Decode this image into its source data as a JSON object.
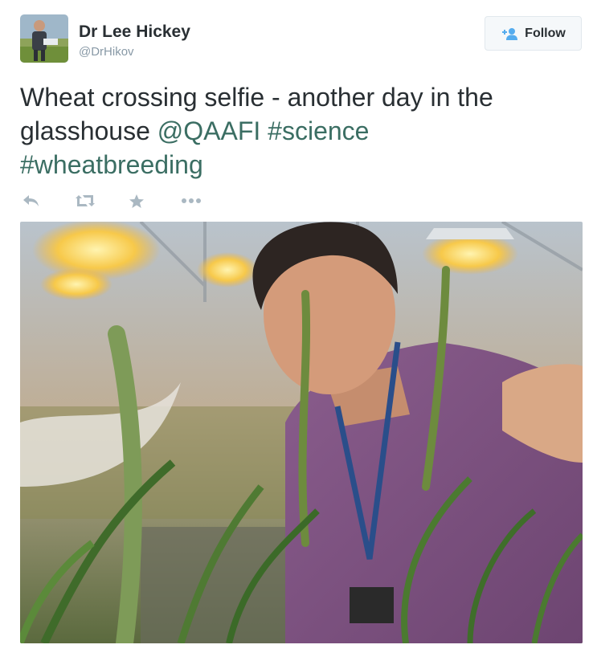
{
  "author": {
    "name": "Dr Lee Hickey",
    "handle": "@DrHikov"
  },
  "follow_button": {
    "label": "Follow"
  },
  "tweet": {
    "text_lead": "Wheat crossing selfie - another day in the glasshouse ",
    "mention": "@QAAFI",
    "hashtag1": "#science",
    "hashtag2": "#wheatbreeding"
  },
  "actions": {
    "icons": [
      "reply-icon",
      "retweet-icon",
      "favorite-icon",
      "more-icon"
    ]
  },
  "colors": {
    "link": "#3b6e63",
    "text": "#292f33",
    "muted": "#8899a6",
    "action_icon": "#aab8c2"
  }
}
